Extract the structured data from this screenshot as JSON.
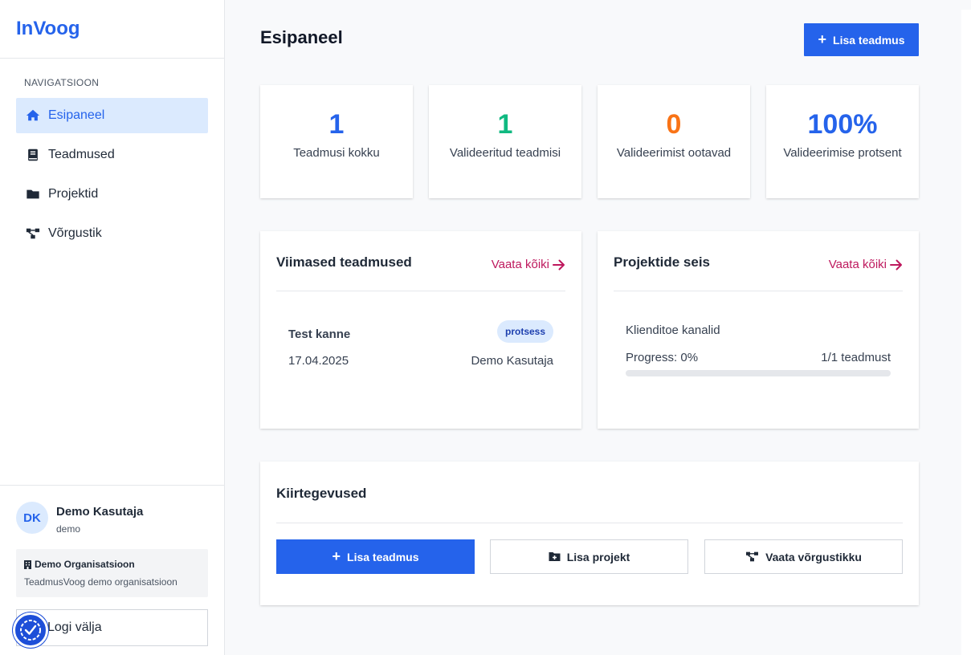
{
  "app": {
    "brand": "InVoog"
  },
  "sidebar": {
    "heading": "NAVIGATSIOON",
    "items": [
      {
        "label": "Esipaneel",
        "icon": "home-icon",
        "active": true
      },
      {
        "label": "Teadmused",
        "icon": "book-icon",
        "active": false
      },
      {
        "label": "Projektid",
        "icon": "folder-icon",
        "active": false
      },
      {
        "label": "Võrgustik",
        "icon": "network-icon",
        "active": false
      }
    ],
    "user": {
      "initials": "DK",
      "name": "Demo Kasutaja",
      "handle": "demo"
    },
    "org": {
      "name": "Demo Organisatsioon",
      "description": "TeadmusVoog demo organisatsioon"
    },
    "logout_label": "Logi välja"
  },
  "header": {
    "title": "Esipaneel",
    "add_button": "Lisa teadmus"
  },
  "stats": [
    {
      "value": "1",
      "label": "Teadmusi kokku",
      "color": "#2563eb"
    },
    {
      "value": "1",
      "label": "Valideeritud teadmisi",
      "color": "#10b981"
    },
    {
      "value": "0",
      "label": "Valideerimist ootavad",
      "color": "#f97316"
    },
    {
      "value": "100%",
      "label": "Valideerimise protsent",
      "color": "#2563eb"
    }
  ],
  "recent": {
    "title": "Viimased teadmused",
    "link": "Vaata kõiki",
    "entries": [
      {
        "title": "Test kanne",
        "badge": "protsess",
        "date": "17.04.2025",
        "author": "Demo Kasutaja"
      }
    ]
  },
  "projects": {
    "title": "Projektide seis",
    "link": "Vaata kõiki",
    "items": [
      {
        "name": "Klienditoe kanalid",
        "progress_label": "Progress: 0%",
        "progress": 0,
        "count": "1/1 teadmust"
      }
    ]
  },
  "quick": {
    "title": "Kiirtegevused",
    "actions": [
      {
        "label": "Lisa teadmus",
        "icon": "plus-icon"
      },
      {
        "label": "Lisa projekt",
        "icon": "folder-plus-icon"
      },
      {
        "label": "Vaata võrgustikku",
        "icon": "network-icon"
      }
    ]
  },
  "colors": {
    "accent": "#2563eb",
    "link": "#be185d"
  }
}
